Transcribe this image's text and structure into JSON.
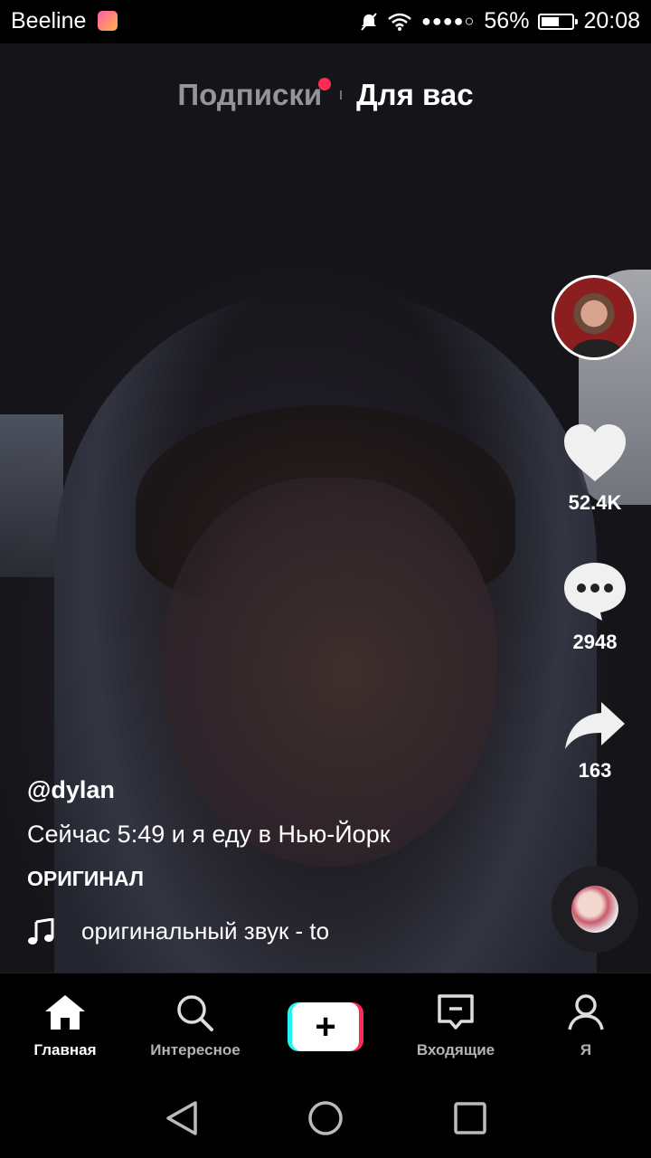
{
  "status_bar": {
    "carrier": "Beeline",
    "signal_dots": "●●●●○",
    "battery": "56%",
    "time": "20:08"
  },
  "top_tabs": {
    "following": "Подписки",
    "for_you": "Для вас"
  },
  "video": {
    "likes": "52.4K",
    "comments": "2948",
    "shares": "163",
    "username": "@dylan",
    "description": "Сейчас 5:49 и я еду в Нью-Йорк",
    "original_label": "ОРИГИНАЛ",
    "sound": "оригинальный звук - to"
  },
  "bottom_nav": {
    "home": "Главная",
    "discover": "Интересное",
    "create": "+",
    "inbox": "Входящие",
    "me": "Я"
  },
  "colors": {
    "accent_red": "#fe2c55",
    "accent_cyan": "#25f4ee",
    "background": "#000000"
  }
}
